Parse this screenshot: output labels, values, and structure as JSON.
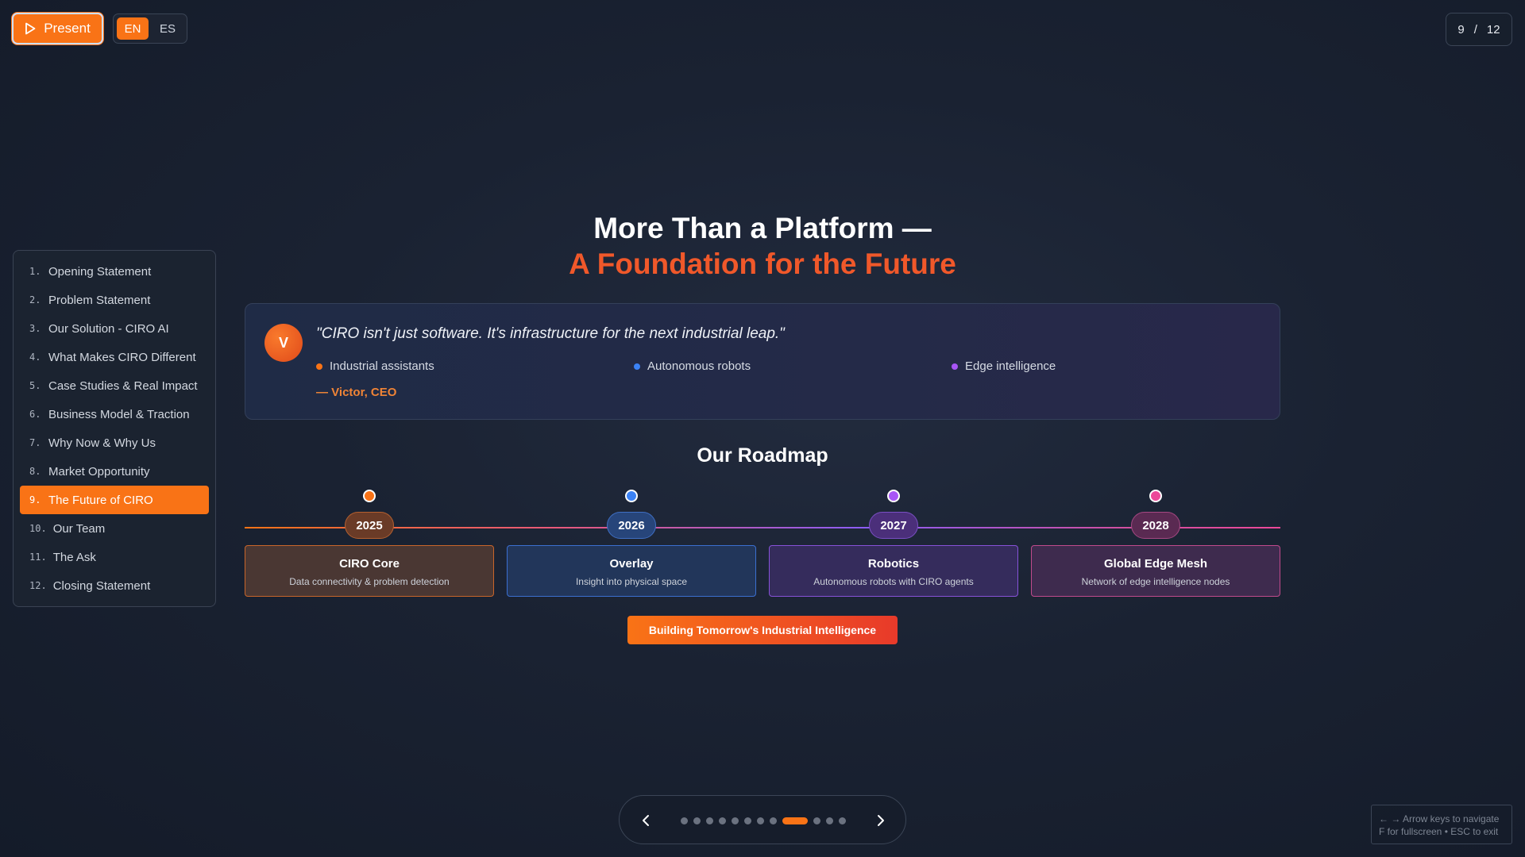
{
  "toolbar": {
    "present_label": "Present",
    "languages": [
      "EN",
      "ES"
    ],
    "active_language": "EN"
  },
  "counter": {
    "current": "9",
    "separator": "/",
    "total": "12"
  },
  "sidebar": {
    "items": [
      {
        "num": "1.",
        "label": "Opening Statement"
      },
      {
        "num": "2.",
        "label": "Problem Statement"
      },
      {
        "num": "3.",
        "label": "Our Solution - CIRO AI"
      },
      {
        "num": "4.",
        "label": "What Makes CIRO Different"
      },
      {
        "num": "5.",
        "label": "Case Studies & Real Impact"
      },
      {
        "num": "6.",
        "label": "Business Model & Traction"
      },
      {
        "num": "7.",
        "label": "Why Now & Why Us"
      },
      {
        "num": "8.",
        "label": "Market Opportunity"
      },
      {
        "num": "9.",
        "label": "The Future of CIRO"
      },
      {
        "num": "10.",
        "label": "Our Team"
      },
      {
        "num": "11.",
        "label": "The Ask"
      },
      {
        "num": "12.",
        "label": "Closing Statement"
      }
    ],
    "active_index": 8
  },
  "slide": {
    "title_line1": "More Than a Platform —",
    "title_line2": "A Foundation for the Future",
    "quote": {
      "avatar_initial": "V",
      "text": "\"CIRO isn't just software. It's infrastructure for the next industrial leap.\"",
      "bullets": [
        {
          "label": "Industrial assistants",
          "color": "#f97316"
        },
        {
          "label": "Autonomous robots",
          "color": "#3b82f6"
        },
        {
          "label": "Edge intelligence",
          "color": "#a855f7"
        }
      ],
      "author": "— Victor, CEO"
    },
    "roadmap_title": "Our Roadmap",
    "milestones": [
      {
        "year": "2025",
        "name": "CIRO Core",
        "desc": "Data connectivity & problem detection",
        "color": "#f97316"
      },
      {
        "year": "2026",
        "name": "Overlay",
        "desc": "Insight into physical space",
        "color": "#3b82f6"
      },
      {
        "year": "2027",
        "name": "Robotics",
        "desc": "Autonomous robots with CIRO agents",
        "color": "#a855f7"
      },
      {
        "year": "2028",
        "name": "Global Edge Mesh",
        "desc": "Network of edge intelligence nodes",
        "color": "#ec4899"
      }
    ],
    "cta_label": "Building Tomorrow's Industrial Intelligence"
  },
  "pager": {
    "prev_icon": "chevron-left-icon",
    "next_icon": "chevron-right-icon",
    "total_slides": 12,
    "current_index": 8
  },
  "help": {
    "line1": "← → Arrow keys to navigate",
    "line2": "F for fullscreen • ESC to exit"
  }
}
